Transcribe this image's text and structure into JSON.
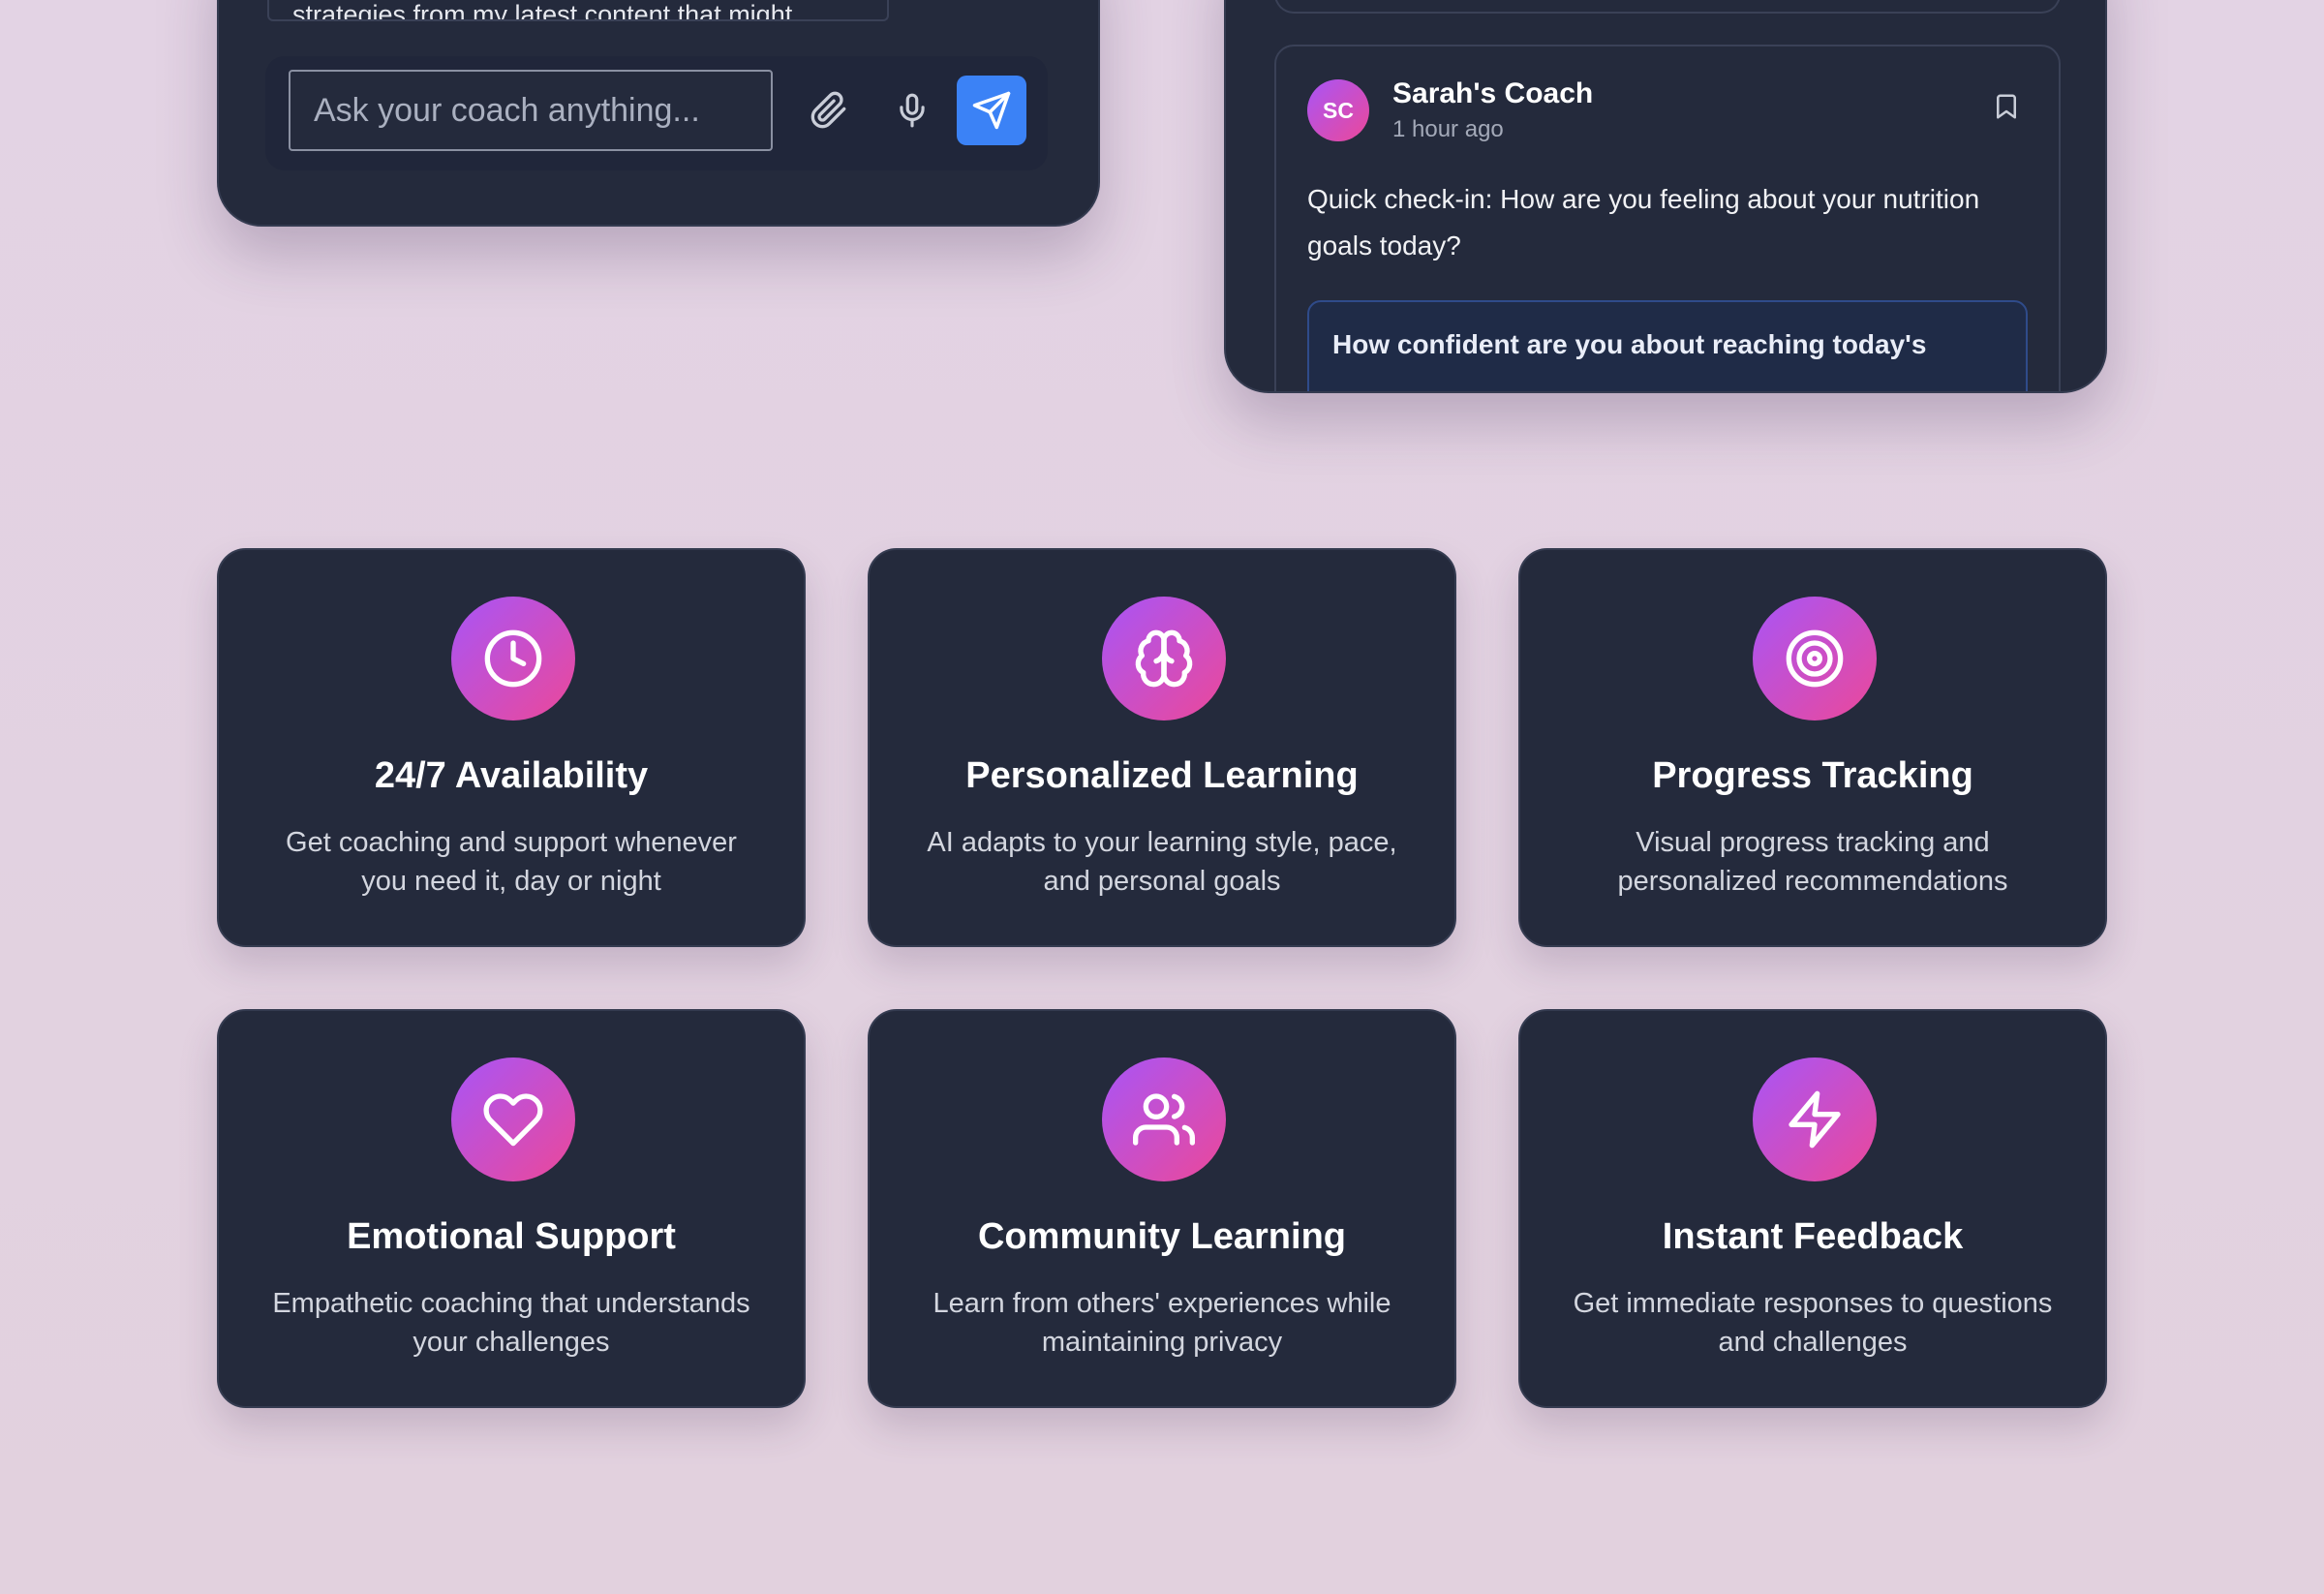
{
  "chat": {
    "previous_message_fragment": "strategies from my latest content that might",
    "input_placeholder": "Ask your coach anything..."
  },
  "notification": {
    "avatar_initials": "SC",
    "sender": "Sarah's Coach",
    "time": "1 hour ago",
    "message": "Quick check-in: How are you feeling about your nutrition goals today?",
    "question": "How confident are you about reaching today's"
  },
  "features": [
    {
      "icon": "clock-icon",
      "title": "24/7 Availability",
      "description": "Get coaching and support whenever you need it, day or night"
    },
    {
      "icon": "brain-icon",
      "title": "Personalized Learning",
      "description": "AI adapts to your learning style, pace, and personal goals"
    },
    {
      "icon": "target-icon",
      "title": "Progress Tracking",
      "description": "Visual progress tracking and personalized recommendations"
    },
    {
      "icon": "heart-icon",
      "title": "Emotional Support",
      "description": "Empathetic coaching that understands your challenges"
    },
    {
      "icon": "users-icon",
      "title": "Community Learning",
      "description": "Learn from others' experiences while maintaining privacy"
    },
    {
      "icon": "lightning-icon",
      "title": "Instant Feedback",
      "description": "Get immediate responses to questions and challenges"
    }
  ],
  "colors": {
    "accent_blue": "#3b82f6",
    "gradient_start": "#a855f7",
    "gradient_end": "#ec4899",
    "card_background": "#242a3c"
  }
}
